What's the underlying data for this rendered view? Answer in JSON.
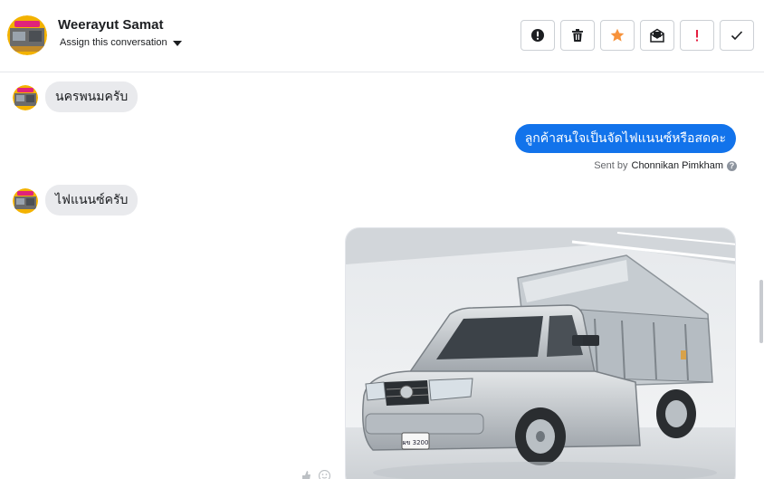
{
  "header": {
    "contact_name": "Weerayut Samat",
    "assign_label": "Assign this conversation",
    "actions": [
      {
        "icon": "alert-circle-icon",
        "name": "mark-spam-button"
      },
      {
        "icon": "trash-icon",
        "name": "delete-button"
      },
      {
        "icon": "star-icon",
        "name": "star-button"
      },
      {
        "icon": "envelope-icon",
        "name": "mark-unread-button"
      },
      {
        "icon": "exclamation-icon",
        "name": "follow-up-button"
      },
      {
        "icon": "check-icon",
        "name": "done-button"
      }
    ]
  },
  "messages": {
    "m1": {
      "text": "นครพนมครับ",
      "direction": "incoming"
    },
    "m2": {
      "text": "ลูกค้าสนใจเป็นจัดไฟแนนซ์หรือสดคะ",
      "direction": "outgoing"
    },
    "sent_by": {
      "prefix": "Sent by",
      "agent": "Chonnikan Pimkham",
      "help": "?"
    },
    "m3": {
      "text": "ไฟแนนซ์ครับ",
      "direction": "incoming"
    },
    "m4": {
      "type": "image",
      "subject": "silver pickup truck with dump bed",
      "plate_text": "ผข 3200"
    }
  },
  "colors": {
    "outgoing_bubble": "#1273eb",
    "incoming_bubble": "#e9eaed",
    "star": "#f7923b",
    "follow_up": "#e41e3f"
  }
}
